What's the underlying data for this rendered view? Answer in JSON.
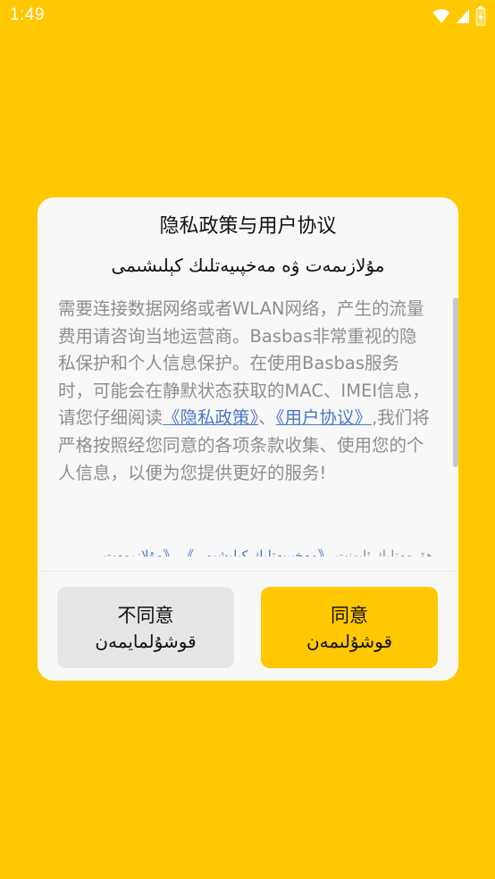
{
  "status": {
    "time": "1:49",
    "icons": [
      "wifi-icon",
      "cell-signal-icon",
      "battery-icon"
    ]
  },
  "dialog": {
    "title": "隐私政策与用户协议",
    "subtitle": "مۇلازىمەت ۋە مەخپىيەتلىك كېلىشىمى",
    "body": {
      "intro": "需要连接数据网络或者WLAN网络，产生的流量费用请咨询当地运营商。Basbas非常重视的隐私保护和个人信息保护。在使用Basbas服务时，可能会在静默状态获取的MAC、IMEI信息，请您仔细阅读",
      "privacy_link": "《隐私政策》",
      "separator": "、",
      "user_link": "《用户协议》",
      "outro": ",我们将严格按照经您同意的各项条款收集、使用您的个人信息，以便为您提供更好的服务!"
    },
    "uyghur_body": {
      "prefix": "ھۆرمەتلىك ئابونت،",
      "link1": "《مەخپىيەتلىك كېلىشىمى》",
      "sep": "،",
      "link2": "《مۇلازىمەت"
    },
    "buttons": {
      "disagree_cn": "不同意",
      "disagree_ug": "قوشۇلمايمەن",
      "agree_cn": "同意",
      "agree_ug": "قوشۇلىمەن"
    }
  },
  "colors": {
    "background": "#FFC800",
    "dialog": "#F8F8F8",
    "link": "#4A78C5",
    "body_text": "#8E8E8E"
  }
}
